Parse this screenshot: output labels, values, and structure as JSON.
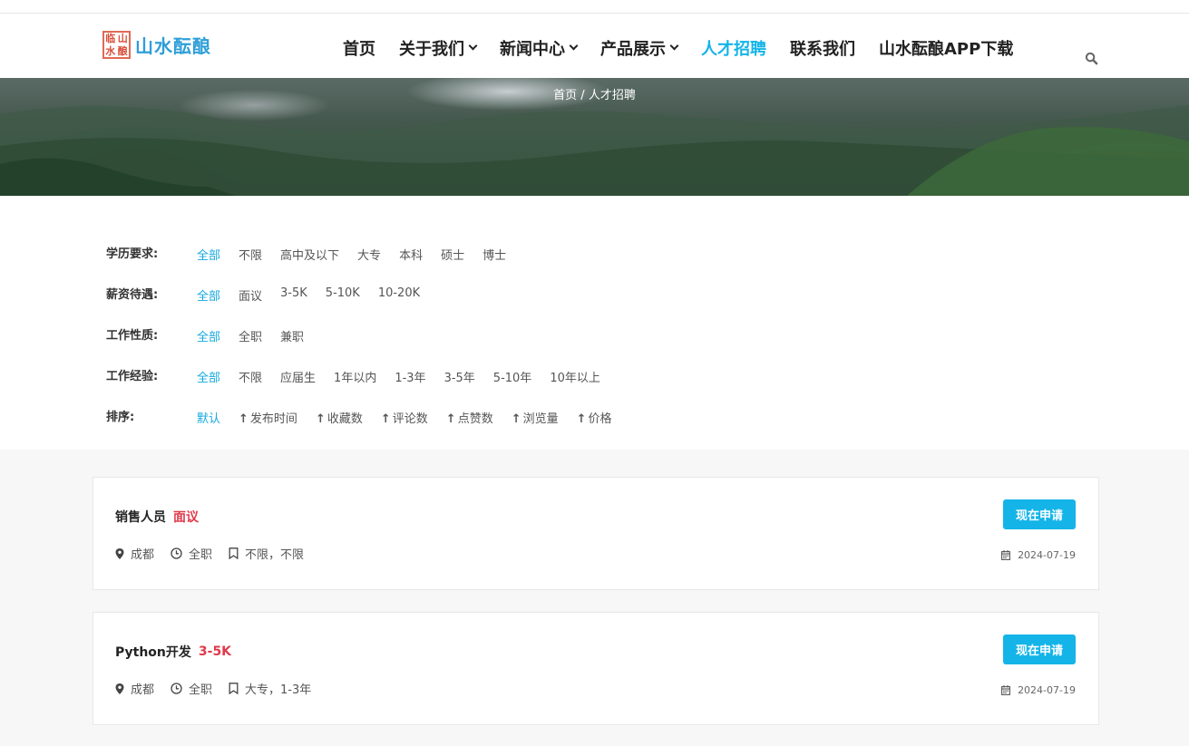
{
  "brand": {
    "name": "山水酝酿",
    "seal_chars": [
      "临",
      "山",
      "水",
      "酿"
    ]
  },
  "nav": [
    {
      "label": "首页",
      "dropdown": false,
      "active": false
    },
    {
      "label": "关于我们",
      "dropdown": true,
      "active": false
    },
    {
      "label": "新闻中心",
      "dropdown": true,
      "active": false
    },
    {
      "label": "产品展示",
      "dropdown": true,
      "active": false
    },
    {
      "label": "人才招聘",
      "dropdown": false,
      "active": true
    },
    {
      "label": "联系我们",
      "dropdown": false,
      "active": false
    },
    {
      "label": "山水酝酿APP下载",
      "dropdown": false,
      "active": false
    }
  ],
  "breadcrumb": "首页 / 人才招聘",
  "filters": [
    {
      "label": "学历要求:",
      "options": [
        "全部",
        "不限",
        "高中及以下",
        "大专",
        "本科",
        "硕士",
        "博士"
      ],
      "selected": 0
    },
    {
      "label": "薪资待遇:",
      "options": [
        "全部",
        "面议",
        "3-5K",
        "5-10K",
        "10-20K"
      ],
      "selected": 0
    },
    {
      "label": "工作性质:",
      "options": [
        "全部",
        "全职",
        "兼职"
      ],
      "selected": 0
    },
    {
      "label": "工作经验:",
      "options": [
        "全部",
        "不限",
        "应届生",
        "1年以内",
        "1-3年",
        "3-5年",
        "5-10年",
        "10年以上"
      ],
      "selected": 0
    },
    {
      "label": "排序:",
      "options": [
        "默认",
        "发布时间",
        "收藏数",
        "评论数",
        "点赞数",
        "浏览量",
        "价格"
      ],
      "selected": 0,
      "arrows": true
    }
  ],
  "jobs": [
    {
      "title": "销售人员",
      "salary": "面议",
      "location": "成都",
      "type": "全职",
      "requirements": "不限，不限",
      "date": "2024-07-19",
      "apply_label": "现在申请"
    },
    {
      "title": "Python开发",
      "salary": "3-5K",
      "location": "成都",
      "type": "全职",
      "requirements": "大专，1-3年",
      "date": "2024-07-19",
      "apply_label": "现在申请"
    }
  ],
  "colors": {
    "accent": "#14b4e8",
    "salary": "#e03a4b",
    "brand": "#2e9fd8",
    "seal": "#d94f3a"
  }
}
